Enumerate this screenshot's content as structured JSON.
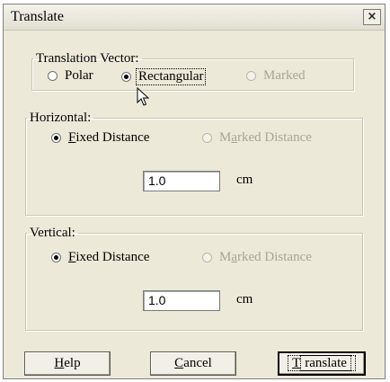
{
  "window": {
    "title": "Translate",
    "close_symbol": "×",
    "close_icon": "close-icon"
  },
  "translation_vector": {
    "legend": "Translation Vector:",
    "options": [
      {
        "label": "Polar",
        "state": "unchecked"
      },
      {
        "label": "Rectangular",
        "state": "checked"
      },
      {
        "label": "Marked",
        "state": "disabled"
      }
    ]
  },
  "horizontal": {
    "legend": "Horizontal:",
    "fixed_label_key": "F",
    "fixed_label_rest": "ixed Distance",
    "fixed_state": "checked",
    "marked_label_pre": "M",
    "marked_label_key": "a",
    "marked_label_rest": "rked Distance",
    "marked_state": "disabled",
    "value": "1.0",
    "unit": "cm"
  },
  "vertical": {
    "legend": "Vertical:",
    "fixed_label_key": "F",
    "fixed_label_rest": "ixed Distance",
    "fixed_state": "checked",
    "marked_label_pre": "M",
    "marked_label_key": "a",
    "marked_label_rest": "rked Distance",
    "marked_state": "disabled",
    "value": "1.0",
    "unit": "cm"
  },
  "buttons": {
    "help_key": "H",
    "help_rest": "elp",
    "cancel_key": "C",
    "cancel_rest": "ancel",
    "translate_key": "T",
    "translate_rest": "ranslate"
  },
  "icons": {
    "cursor": "arrow-cursor-icon"
  }
}
